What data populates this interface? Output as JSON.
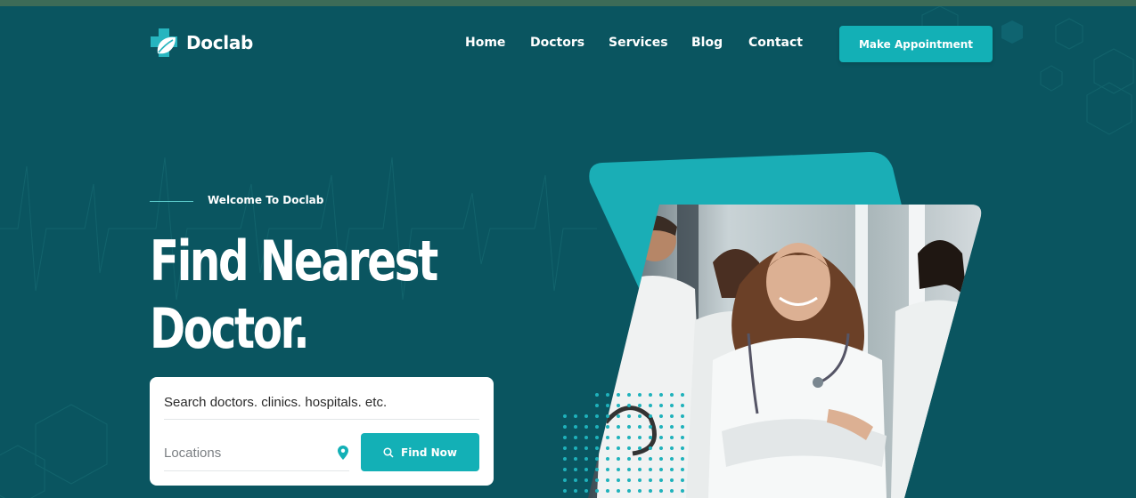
{
  "header": {
    "logo_text": "Doclab",
    "nav": [
      {
        "label": "Home"
      },
      {
        "label": "Doctors"
      },
      {
        "label": "Services"
      },
      {
        "label": "Blog"
      },
      {
        "label": "Contact"
      }
    ],
    "cta_label": "Make Appointment"
  },
  "hero": {
    "eyebrow": "Welcome To Doclab",
    "title_line1": "Find Nearest",
    "title_line2": "Doctor."
  },
  "search": {
    "query_placeholder": "Search doctors. clinics. hospitals. etc.",
    "location_placeholder": "Locations",
    "button_label": "Find Now",
    "button_icon": "search-icon",
    "location_icon": "map-pin-icon"
  },
  "colors": {
    "background": "#0a5560",
    "accent": "#13b0b6",
    "card": "#ffffff"
  }
}
